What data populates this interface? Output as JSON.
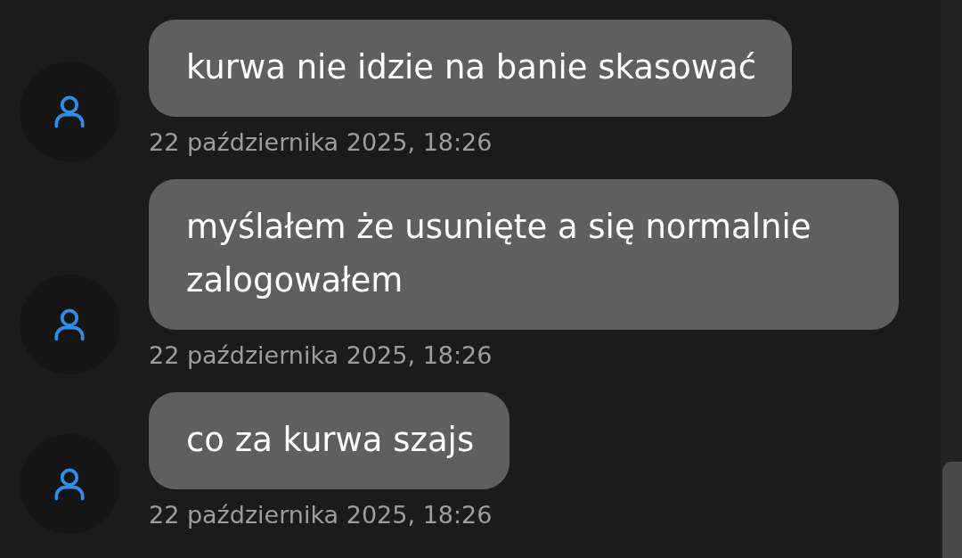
{
  "messages": [
    {
      "text": "kurwa nie idzie na banie skasować",
      "time": "22 października 2025, 18:26"
    },
    {
      "text": "myślałem że usunięte a się normalnie zalogowałem",
      "time": "22 października 2025, 18:26"
    },
    {
      "text": "co za kurwa szajs",
      "time": "22 października 2025, 18:26"
    }
  ]
}
